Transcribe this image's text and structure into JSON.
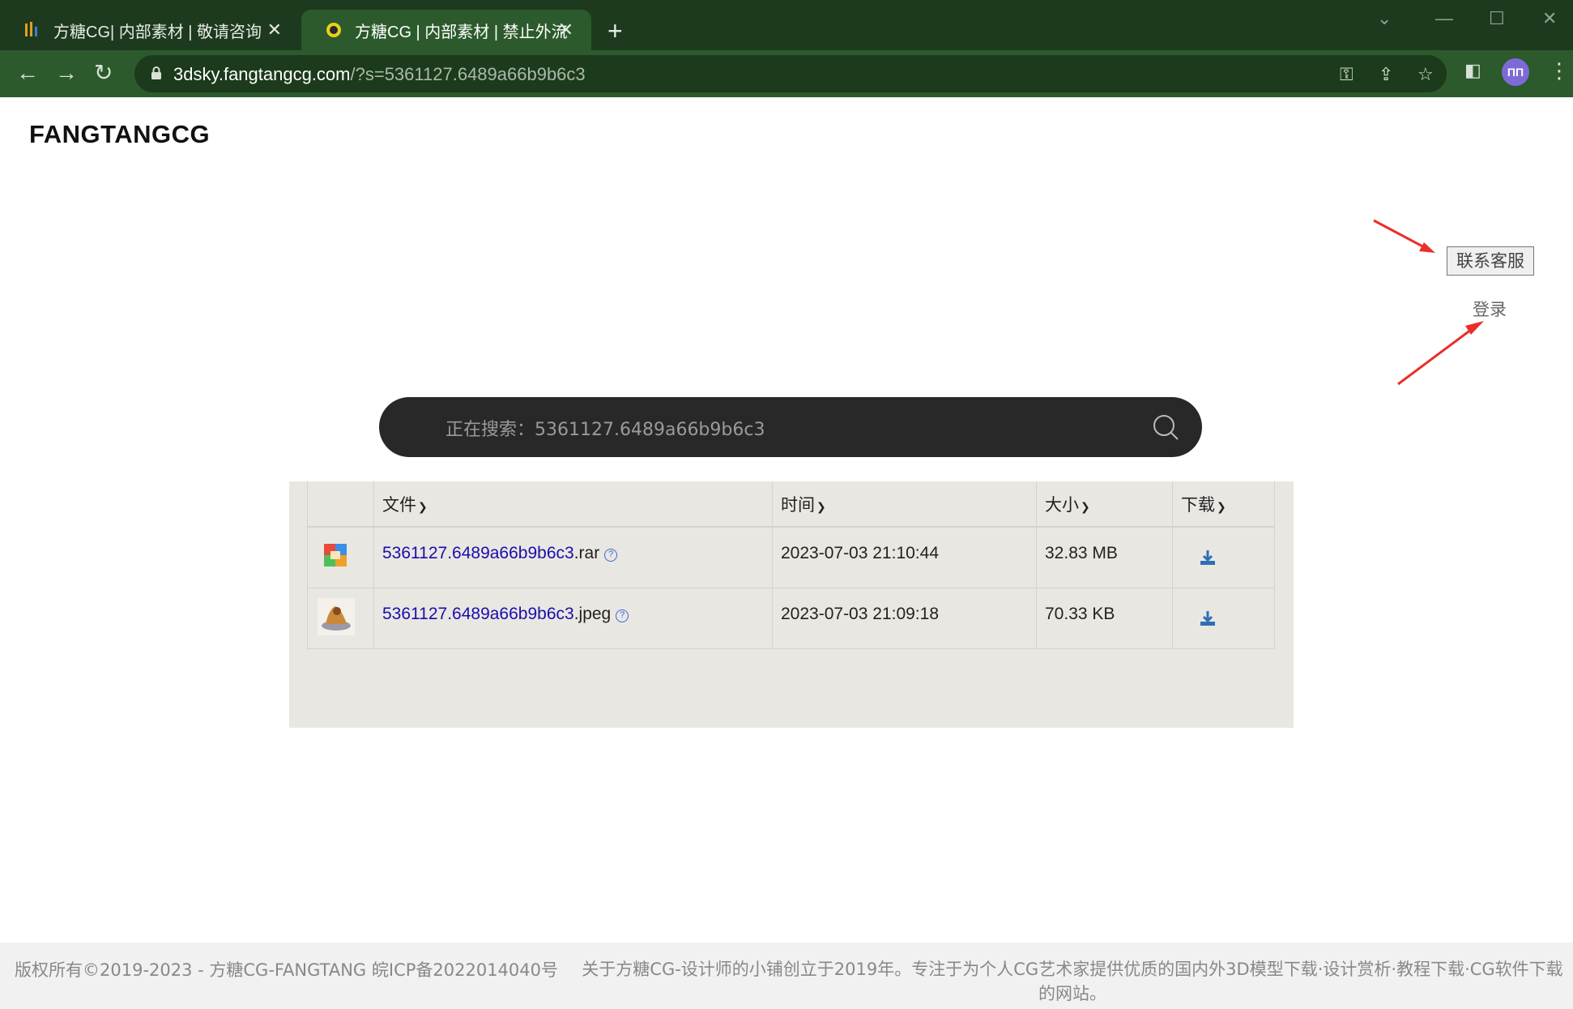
{
  "browser": {
    "tabs": [
      {
        "title": "方糖CG| 内部素材 | 敬请咨询",
        "active": false
      },
      {
        "title": "方糖CG | 内部素材 | 禁止外流",
        "active": true
      }
    ],
    "url_host": "3dsky.fangtangcg.com",
    "url_rest": "/?s=5361127.6489a66b9b6c3",
    "avatar_text": "ΠΠ"
  },
  "page": {
    "logo": "FANGTANGCG",
    "contact_button": "联系客服",
    "login_link": "登录",
    "search": {
      "placeholder": "正在搜索：5361127.6489a66b9b6c3"
    },
    "table": {
      "headers": {
        "file": "文件",
        "time": "时间",
        "size": "大小",
        "download": "下载"
      },
      "rows": [
        {
          "name": "5361127.6489a66b9b6c3",
          "ext": ".rar",
          "time": "2023-07-03 21:10:44",
          "size": "32.83 MB",
          "icon": "archive-icon"
        },
        {
          "name": "5361127.6489a66b9b6c3",
          "ext": ".jpeg",
          "time": "2023-07-03 21:09:18",
          "size": "70.33 KB",
          "icon": "image-thumbnail"
        }
      ]
    },
    "footer": {
      "copyright": "版权所有©2019-2023 - 方糖CG-FANGTANG 皖ICP备2022014040号",
      "about": "关于方糖CG-设计师的小铺创立于2019年。专注于为个人CG艺术家提供优质的国内外3D模型下载·设计赏析·教程下载·CG软件下载的网站。"
    }
  },
  "colors": {
    "chrome_dark": "#1e3a1e",
    "chrome": "#2c5a2c",
    "link": "#1a0dab",
    "search_bg": "#282828",
    "arrow": "#e8302a"
  }
}
